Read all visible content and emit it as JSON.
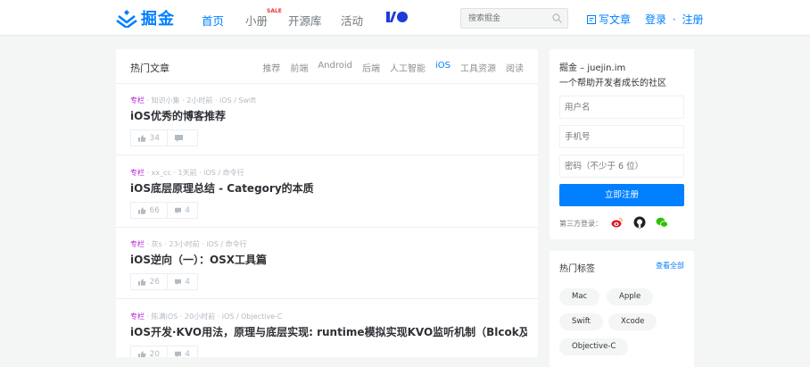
{
  "header": {
    "logo_text": "掘金",
    "nav": [
      "首页",
      "小册",
      "开源库",
      "活动"
    ],
    "sale_badge": "SALE",
    "search_placeholder": "搜索掘金",
    "write": "写文章",
    "login": "登录",
    "separator": "·",
    "register": "注册",
    "accent_color": "#007fff"
  },
  "feed": {
    "title": "热门文章",
    "tags": [
      "推荐",
      "前端",
      "Android",
      "后端",
      "人工智能",
      "iOS",
      "工具资源",
      "阅读"
    ],
    "active_tag": "iOS",
    "entries": [
      {
        "column": "专栏",
        "author": "知识小集",
        "time": "2小时前",
        "category": "iOS / Swift",
        "title": "iOS优秀的博客推荐",
        "likes": "34",
        "comments": ""
      },
      {
        "column": "专栏",
        "author": "xx_cc",
        "time": "1天前",
        "category": "iOS / 命令行",
        "title": "iOS底层原理总结 - Category的本质",
        "likes": "66",
        "comments": "4"
      },
      {
        "column": "专栏",
        "author": "灰s",
        "time": "23小时前",
        "category": "iOS / 命令行",
        "title": "iOS逆向（一）：OSX工具篇",
        "likes": "26",
        "comments": "4"
      },
      {
        "column": "专栏",
        "author": "陈满iOS",
        "time": "20小时前",
        "category": "iOS / Objective-C",
        "title": "iOS开发·KVO用法，原理与底层实现: runtime模拟实现KVO监听机制（Blcok及Delga...",
        "likes": "20",
        "comments": "4"
      }
    ]
  },
  "register": {
    "title": "掘金 – juejin.im",
    "subtitle": "一个帮助开发者成长的社区",
    "username_placeholder": "用户名",
    "phone_placeholder": "手机号",
    "password_placeholder": "密码（不少于 6 位）",
    "submit": "立即注册",
    "third_party": "第三方登录："
  },
  "hot_tags": {
    "title": "热门标签",
    "view_all": "查看全部",
    "tags": [
      "Mac",
      "Apple",
      "Swift",
      "Xcode",
      "Objective-C"
    ]
  }
}
